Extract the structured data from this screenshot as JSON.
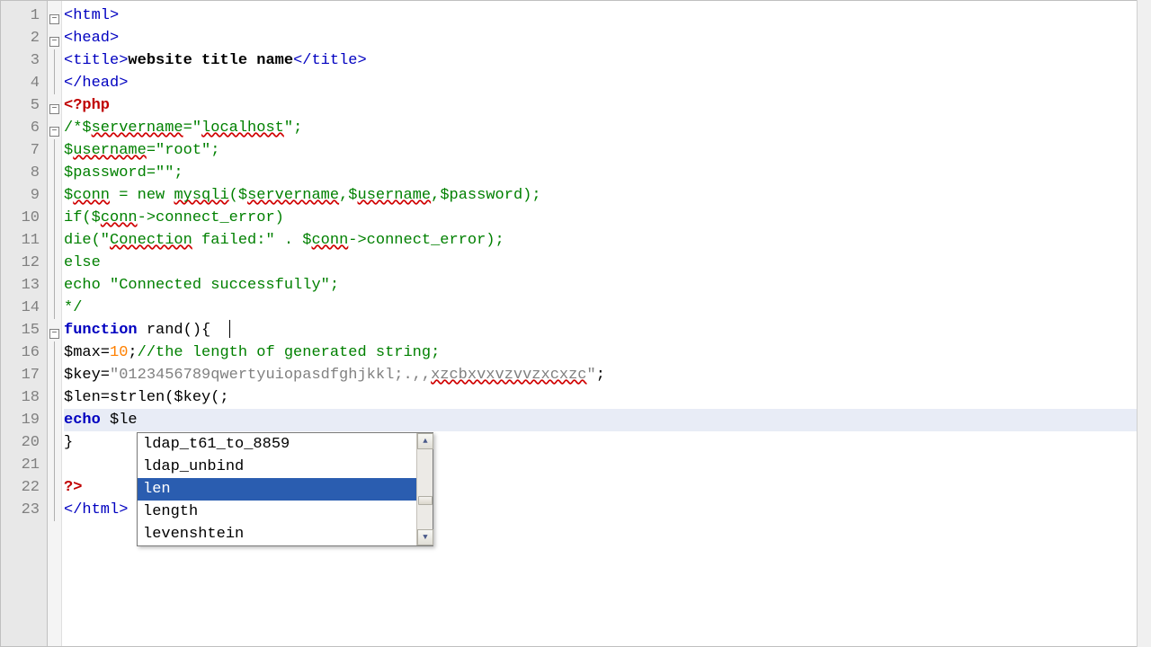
{
  "line_numbers": [
    "1",
    "2",
    "3",
    "4",
    "5",
    "6",
    "7",
    "8",
    "9",
    "10",
    "11",
    "12",
    "13",
    "14",
    "15",
    "16",
    "17",
    "18",
    "19",
    "20",
    "21",
    "22",
    "23"
  ],
  "fold": {
    "minus_rows": [
      1,
      2,
      5,
      6,
      15
    ],
    "line_rows": [
      3,
      4,
      7,
      8,
      9,
      10,
      11,
      12,
      13,
      14,
      16,
      17,
      18,
      19,
      20,
      21,
      22,
      23
    ]
  },
  "code": {
    "l1": "<html>",
    "l2": "<head>",
    "l3_open": "<title>",
    "l3_text": "website title name",
    "l3_close": "</title>",
    "l4": "</head>",
    "l5": "<?php",
    "l6_a": "/*$",
    "l6_b": "servername",
    "l6_c": "=\"",
    "l6_d": "localhost",
    "l6_e": "\";",
    "l7_a": "$",
    "l7_b": "username",
    "l7_c": "=\"root\";",
    "l8": "$password=\"\";",
    "l9_a": "$",
    "l9_b": "conn",
    "l9_c": " = new ",
    "l9_d": "mysqli",
    "l9_e": "($",
    "l9_f": "servername",
    "l9_g": ",$",
    "l9_h": "username",
    "l9_i": ",$password);",
    "l10_a": "if($",
    "l10_b": "conn",
    "l10_c": "->connect_error)",
    "l11_a": "die(\"",
    "l11_b": "Conection",
    "l11_c": " failed:\" . $",
    "l11_d": "conn",
    "l11_e": "->connect_error);",
    "l12": "else",
    "l13": "echo \"Connected successfully\";",
    "l14": "*/",
    "l15_a": "function",
    "l15_b": " rand",
    "l15_c": "(){",
    "l16_a": "$max=",
    "l16_b": "10",
    "l16_c": ";",
    "l16_d": "//the length of generated string;",
    "l17_a": "$key=",
    "l17_b": "\"0123456789qwertyuiopasdfghjkkl;.,,",
    "l17_c": "xzcbxvxvzvvzxcxzc",
    "l17_d": "\"",
    "l17_e": ";",
    "l18": "$len=strlen($key(;",
    "l19_a": "echo",
    "l19_b": " $le",
    "l20": "}",
    "l21": "",
    "l22": "?>",
    "l23": "</html>"
  },
  "autocomplete": {
    "items": [
      {
        "label": "ldap_t61_to_8859"
      },
      {
        "label": "ldap_unbind"
      },
      {
        "label": "len"
      },
      {
        "label": "length"
      },
      {
        "label": "levenshtein"
      }
    ],
    "selected_index": 2
  }
}
